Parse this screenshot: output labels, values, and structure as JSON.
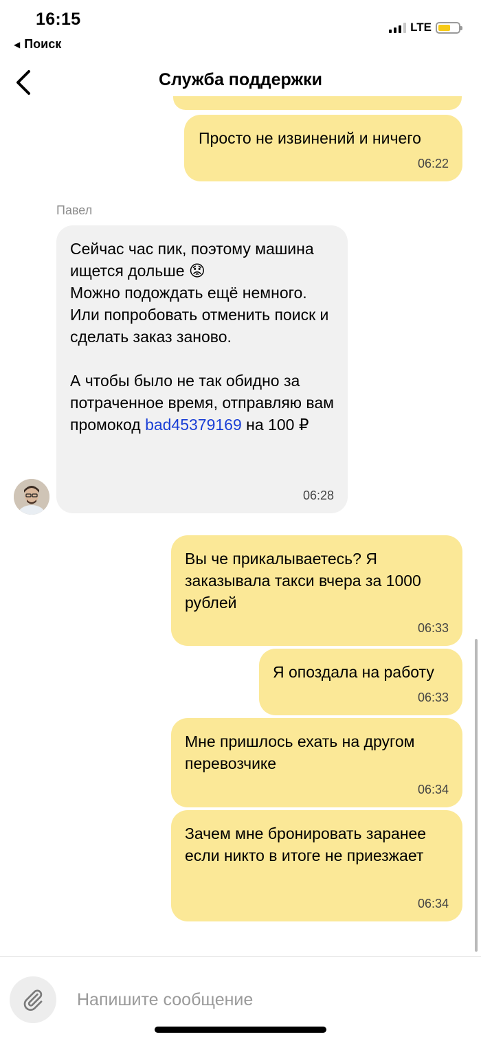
{
  "status_bar": {
    "time": "16:15",
    "back_app_label": "Поиск",
    "network": "LTE",
    "battery_level": 0.6
  },
  "header": {
    "title": "Служба поддержки"
  },
  "chat": {
    "agent_name": "Павел",
    "messages": [
      {
        "direction": "out",
        "text": "Просто не извинений и ничего",
        "time": "06:22"
      },
      {
        "direction": "in",
        "text_part1": "Сейчас час пик, поэтому машина ищется дольше 😟\nМожно подождать ещё немного. Или попробовать отменить поиск и сделать заказ заново.\n\nА чтобы было не так обидно за потраченное время, отправляю вам промокод ",
        "promo_code": "bad45379169",
        "text_part2": " на 100 ₽",
        "time": "06:28"
      },
      {
        "direction": "out",
        "text": "Вы че прикалываетесь? Я заказывала такси вчера за 1000 рублей",
        "time": "06:33"
      },
      {
        "direction": "out",
        "text": "Я опоздала на работу",
        "time": "06:33"
      },
      {
        "direction": "out",
        "text": "Мне пришлось ехать на другом перевозчике",
        "time": "06:34"
      },
      {
        "direction": "out",
        "text": "Зачем мне бронировать заранее если никто в итоге не приезжает",
        "time": "06:34"
      }
    ]
  },
  "composer": {
    "placeholder": "Напишите сообщение",
    "value": ""
  },
  "colors": {
    "outgoing_bubble": "#fbe897",
    "incoming_bubble": "#f1f1f1",
    "link": "#1a3fd6",
    "battery": "#f7ca17"
  },
  "icons": {
    "back": "chevron-left-icon",
    "attach": "paperclip-icon"
  }
}
